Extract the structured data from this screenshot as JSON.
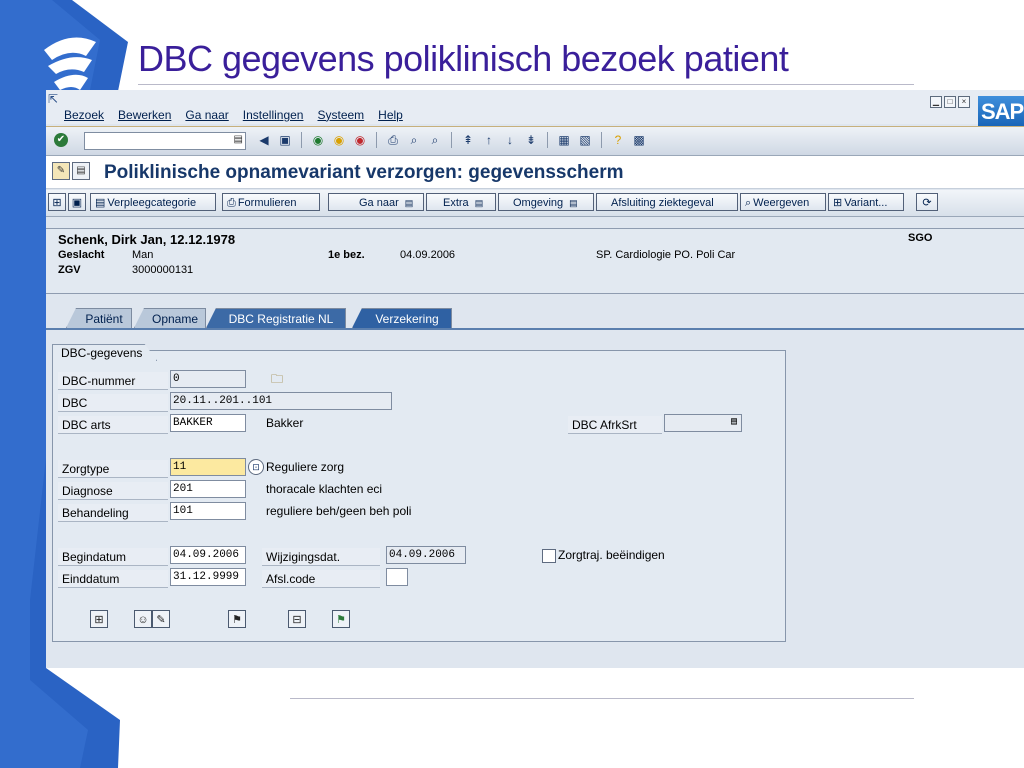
{
  "slide": {
    "title": "DBC gegevens poliklinisch bezoek patient"
  },
  "menu": {
    "items": [
      "Bezoek",
      "Bewerken",
      "Ga naar",
      "Instellingen",
      "Systeem",
      "Help"
    ]
  },
  "sap_logo": "SAP",
  "screen_title": "Poliklinische opnamevariant verzorgen: gegevensscherm",
  "app_buttons": {
    "verpleegcategorie": "Verpleegcategorie",
    "formulieren": "Formulieren",
    "ganaar": "Ga naar",
    "extra": "Extra",
    "omgeving": "Omgeving",
    "afsluiting": "Afsluiting ziektegeval",
    "weergeven": "Weergeven",
    "variant": "Variant..."
  },
  "patient": {
    "name": "Schenk, Dirk Jan, 12.12.1978",
    "org": "SGO",
    "geslacht_label": "Geslacht",
    "geslacht": "Man",
    "bez_label": "1e bez.",
    "bez_date": "04.09.2006",
    "department": "SP. Cardiologie PO. Poli Car",
    "zgv_label": "ZGV",
    "zgv": "3000000131"
  },
  "tabs": [
    "Patiënt",
    "Opname",
    "DBC Registratie NL",
    "Verzekering"
  ],
  "group_title": "DBC-gegevens",
  "form": {
    "dbc_nummer_label": "DBC-nummer",
    "dbc_nummer": "0",
    "dbc_label": "DBC",
    "dbc": "20.11..201..101",
    "dbc_arts_label": "DBC arts",
    "dbc_arts": "BAKKER",
    "dbc_arts_text": "Bakker",
    "afrksrt_label": "DBC AfrkSrt",
    "afrksrt": "",
    "zorgtype_label": "Zorgtype",
    "zorgtype": "11",
    "zorgtype_text": "Reguliere zorg",
    "diagnose_label": "Diagnose",
    "diagnose": "201",
    "diagnose_text": "thoracale klachten eci",
    "behandeling_label": "Behandeling",
    "behandeling": "101",
    "behandeling_text": "reguliere beh/geen beh poli",
    "begindatum_label": "Begindatum",
    "begindatum": "04.09.2006",
    "wijzigingsdat_label": "Wijzigingsdat.",
    "wijzigingsdat": "04.09.2006",
    "zorgtraj_label": "Zorgtraj. beëindigen",
    "einddatum_label": "Einddatum",
    "einddatum": "31.12.9999",
    "afsl_label": "Afsl.code",
    "afsl": ""
  },
  "colors": {
    "title": "#3a1f9a",
    "slide_blue": "#2a63c4",
    "active_tab": "#3c6aa6"
  }
}
